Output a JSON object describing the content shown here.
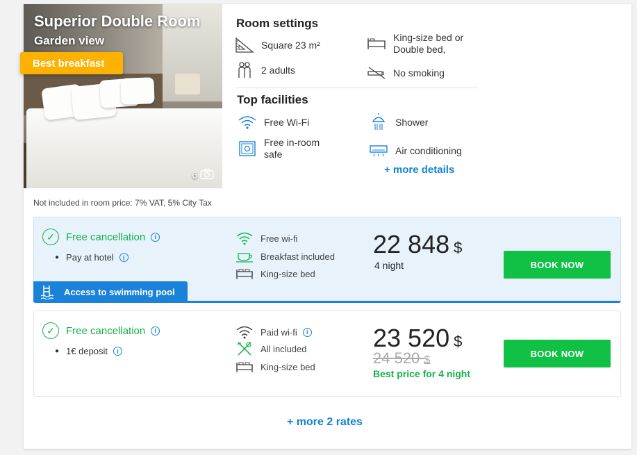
{
  "room": {
    "title": "Superior Double Room",
    "view": "Garden view",
    "badge": "Best breakfast",
    "photo_count": "6"
  },
  "settings": {
    "title": "Room settings",
    "items": [
      {
        "icon": "square-ruler-icon",
        "label": "Square 23 m²"
      },
      {
        "icon": "double-bed-icon",
        "label": "King-size bed or Double bed,"
      },
      {
        "icon": "adults-icon",
        "label": "2 adults"
      },
      {
        "icon": "no-smoking-icon",
        "label": "No smoking"
      }
    ]
  },
  "facilities": {
    "title": "Top facilities",
    "items": [
      {
        "icon": "wifi-icon",
        "label": "Free Wi-Fi"
      },
      {
        "icon": "shower-icon",
        "label": "Shower"
      },
      {
        "icon": "safe-icon",
        "label": "Free in-room safe"
      },
      {
        "icon": "air-conditioning-icon",
        "label": "Air conditioning"
      }
    ],
    "more_link": "+ more details"
  },
  "tax_note": "Not included in room price: 7% VAT, 5% City Tax",
  "rates": [
    {
      "cancellation": "Free cancellation",
      "payment": "Pay at hotel",
      "amenities": [
        {
          "icon": "wifi-icon",
          "label": "Free wi-fi"
        },
        {
          "icon": "breakfast-icon",
          "label": "Breakfast included"
        },
        {
          "icon": "bed-icon",
          "label": "King-size bed"
        }
      ],
      "price": "22 848",
      "currency": "$",
      "nights": "4 night",
      "book_label": "BOOK NOW",
      "promo": "Access to swimming pool"
    },
    {
      "cancellation": "Free cancellation",
      "payment": "1€ deposit",
      "amenities": [
        {
          "icon": "wifi-icon",
          "label": "Paid wi-fi"
        },
        {
          "icon": "cutlery-icon",
          "label": "All included"
        },
        {
          "icon": "bed-icon",
          "label": "King-size bed"
        }
      ],
      "price": "23 520",
      "currency": "$",
      "old_price": "24 520",
      "old_currency": "$",
      "best_price": "Best price for 4 night",
      "book_label": "BOOK NOW"
    }
  ],
  "more_rates": "+ more 2 rates",
  "colors": {
    "accent_blue": "#1a82d8",
    "green": "#12b24a",
    "button_green": "#10c145",
    "badge_yellow": "#fdb100"
  }
}
